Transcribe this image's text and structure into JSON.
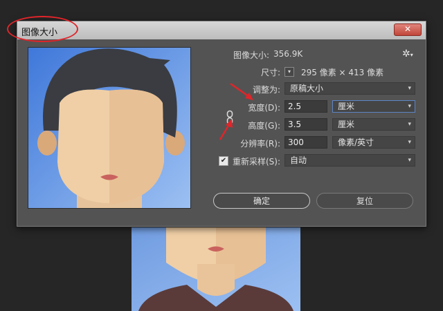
{
  "window": {
    "title": "图像大小",
    "close_icon": "✕"
  },
  "info": {
    "image_size_label": "图像大小:",
    "image_size_value": "356.9K",
    "dimensions_label": "尺寸:",
    "dimensions_value": "295 像素 × 413 像素"
  },
  "fit_to": {
    "label": "调整为:",
    "value": "原稿大小"
  },
  "width": {
    "label": "宽度(D):",
    "value": "2.5",
    "unit": "厘米"
  },
  "height": {
    "label": "高度(G):",
    "value": "3.5",
    "unit": "厘米"
  },
  "resolution": {
    "label": "分辨率(R):",
    "value": "300",
    "unit": "像素/英寸"
  },
  "resample": {
    "label": "重新采样(S):",
    "checked": true,
    "value": "自动"
  },
  "buttons": {
    "ok": "确定",
    "reset": "复位"
  },
  "colors": {
    "annotation": "#e0252a",
    "dialog_bg": "#535353",
    "accent": "#5d85c6"
  },
  "icons": [
    "gear-icon",
    "chevron-down-icon",
    "link-icon",
    "close-icon",
    "checkmark-icon"
  ]
}
